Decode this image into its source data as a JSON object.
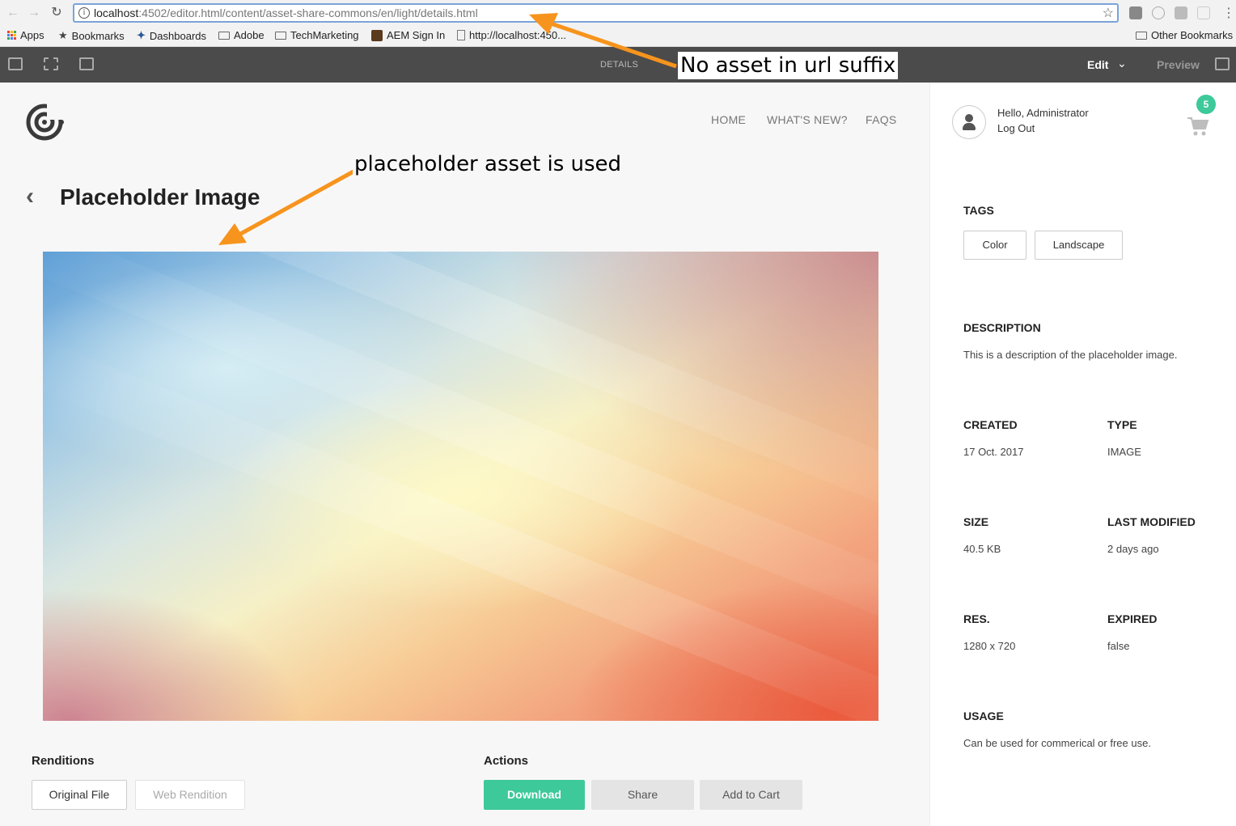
{
  "browser": {
    "url_host": "localhost",
    "url_path": ":4502/editor.html/content/asset-share-commons/en/light/details.html",
    "bookmarks": [
      "Apps",
      "Bookmarks",
      "Dashboards",
      "Adobe",
      "TechMarketing",
      "AEM Sign In",
      "http://localhost:450..."
    ],
    "other_bookmarks": "Other Bookmarks"
  },
  "editor": {
    "mode_label": "DETAILS",
    "edit_label": "Edit",
    "preview_label": "Preview"
  },
  "site_nav": [
    "HOME",
    "WHAT'S NEW?",
    "FAQS"
  ],
  "page": {
    "title": "Placeholder Image"
  },
  "renditions": {
    "heading": "Renditions",
    "original": "Original File",
    "web": "Web Rendition"
  },
  "actions": {
    "heading": "Actions",
    "download": "Download",
    "share": "Share",
    "add_to_cart": "Add to Cart"
  },
  "user": {
    "greeting": "Hello, Administrator",
    "logout": "Log Out",
    "cart_count": "5"
  },
  "details": {
    "tags_label": "TAGS",
    "tags": [
      "Color",
      "Landscape"
    ],
    "description_label": "DESCRIPTION",
    "description": "This is a description of the placeholder image.",
    "created_label": "CREATED",
    "created": "17 Oct. 2017",
    "type_label": "TYPE",
    "type": "IMAGE",
    "size_label": "SIZE",
    "size": "40.5 KB",
    "modified_label": "LAST MODIFIED",
    "modified": "2 days ago",
    "res_label": "RES.",
    "res": "1280 x 720",
    "expired_label": "EXPIRED",
    "expired": "false",
    "usage_label": "USAGE",
    "usage": "Can be used for commerical or free use."
  },
  "annotations": {
    "url_note": "No asset in url suffix",
    "image_note": "placeholder asset is used"
  },
  "colors": {
    "accent": "#3ec99a",
    "annotation_arrow": "#f7941d",
    "editor_bar": "#4b4b4b"
  }
}
